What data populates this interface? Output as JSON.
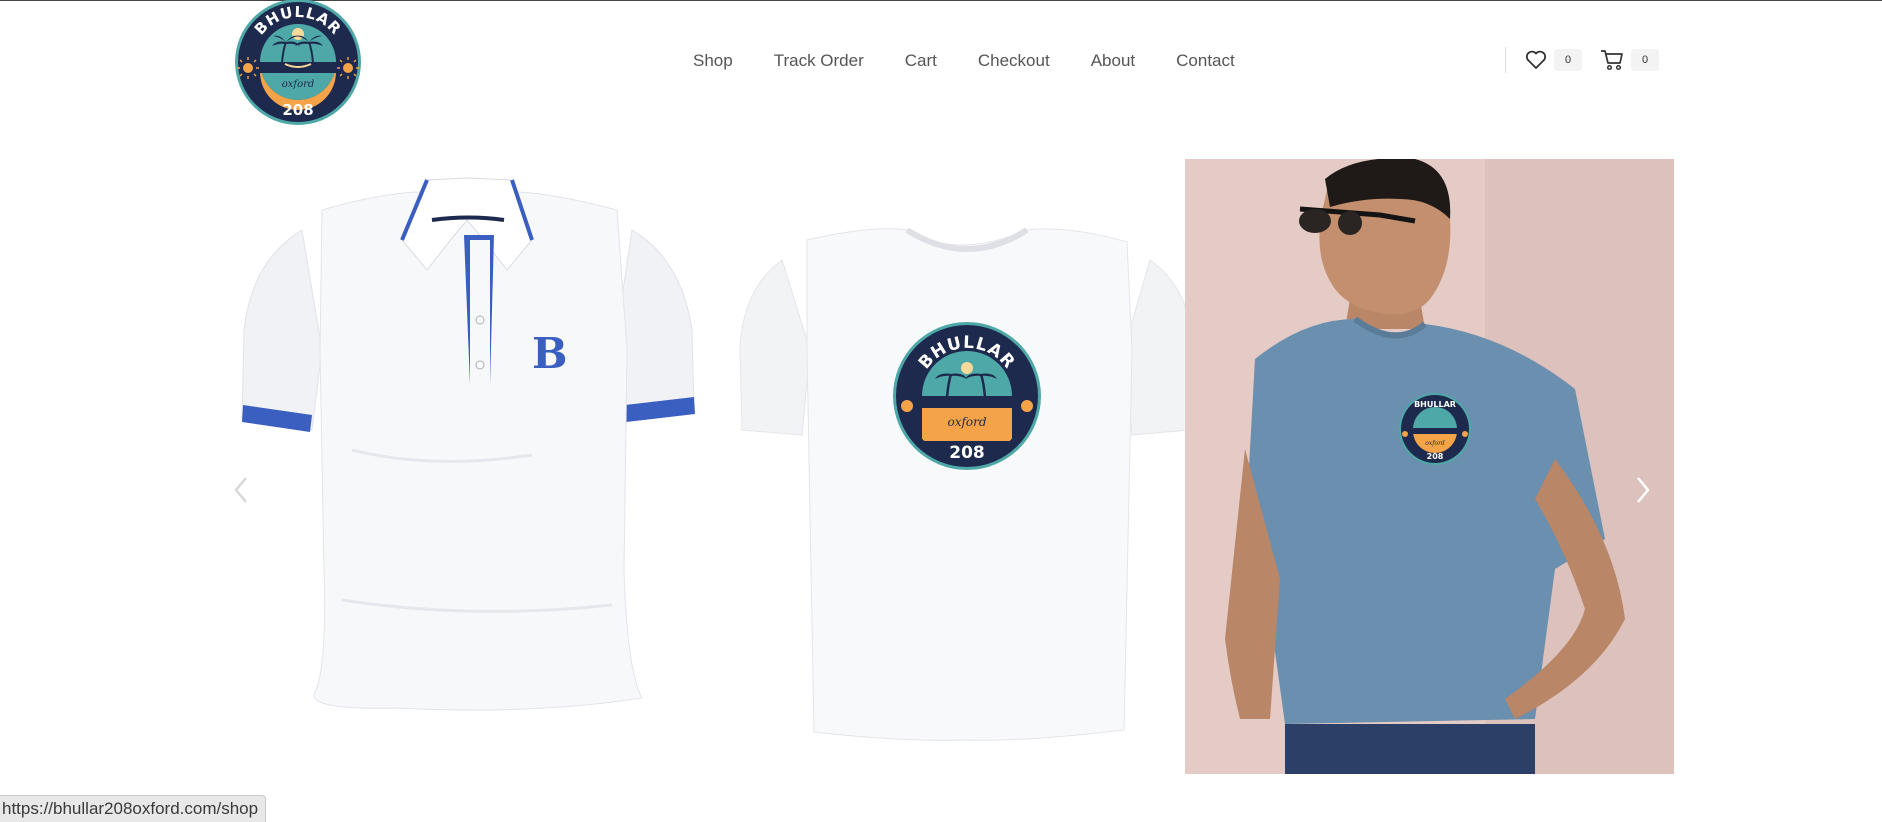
{
  "header": {
    "logo": {
      "top_text": "BHULLAR",
      "middle_text": "oxford",
      "bottom_text": "208"
    },
    "nav": [
      {
        "label": "Shop"
      },
      {
        "label": "Track Order"
      },
      {
        "label": "Cart"
      },
      {
        "label": "Checkout"
      },
      {
        "label": "About"
      },
      {
        "label": "Contact"
      }
    ],
    "wishlist": {
      "icon": "heart-icon",
      "count": "0"
    },
    "cart": {
      "icon": "cart-icon",
      "count": "0"
    }
  },
  "carousel": {
    "slides": [
      {
        "description": "white polo shirt with blue collar trim",
        "emblem_letter": "B"
      },
      {
        "description": "white t-shirt with logo",
        "emblem_top": "BHULLAR",
        "emblem_middle": "oxford",
        "emblem_bottom": "208"
      },
      {
        "description": "man wearing blue t-shirt with logo",
        "emblem_top": "BHULLAR",
        "emblem_middle": "oxford",
        "emblem_bottom": "208"
      }
    ],
    "prev_icon": "chevron-left-icon",
    "next_icon": "chevron-right-icon"
  },
  "status_bar": {
    "url": "https://bhullar208oxford.com/shop"
  },
  "colors": {
    "logo_navy": "#1d2a4d",
    "logo_teal": "#4fa8a8",
    "logo_orange": "#f4a348",
    "polo_blue": "#3b5fc0",
    "tee_blue": "#6b8fae",
    "photo_bg": "#e5cbc6"
  }
}
